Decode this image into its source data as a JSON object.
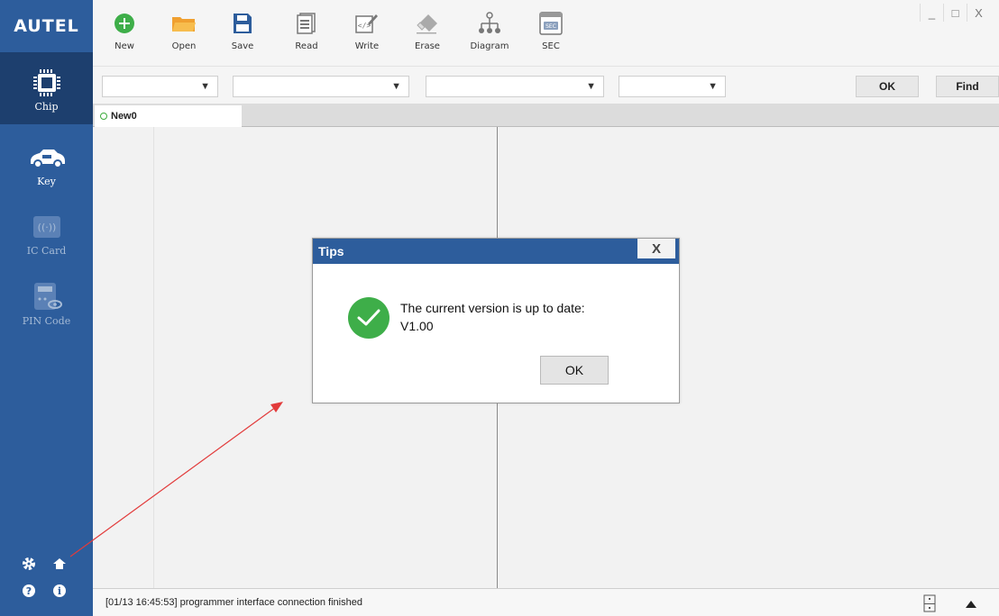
{
  "app": {
    "logo": "AUTEL"
  },
  "colors": {
    "sidebar": "#2d5d9c",
    "sidebar_active": "#1d3f6e",
    "success": "#3eae49",
    "annotation": "#e23b3b"
  },
  "sidebar": {
    "items": [
      {
        "label": "Chip",
        "icon": "chip-icon",
        "active": true
      },
      {
        "label": "Key",
        "icon": "car-key-icon"
      },
      {
        "label": "IC Card",
        "icon": "ic-card-icon",
        "disabled": true
      },
      {
        "label": "PIN Code",
        "icon": "pin-code-icon",
        "disabled": true
      }
    ],
    "bottom_icons": [
      "settings-icon",
      "home-icon",
      "help-icon",
      "info-icon"
    ]
  },
  "toolbar": {
    "items": [
      {
        "label": "New",
        "icon": "plus-circle-icon"
      },
      {
        "label": "Open",
        "icon": "folder-icon"
      },
      {
        "label": "Save",
        "icon": "floppy-icon"
      },
      {
        "label": "Read",
        "icon": "read-icon"
      },
      {
        "label": "Write",
        "icon": "write-icon"
      },
      {
        "label": "Erase",
        "icon": "eraser-icon"
      },
      {
        "label": "Diagram",
        "icon": "diagram-icon"
      },
      {
        "label": "SEC",
        "icon": "sec-icon"
      }
    ],
    "window_controls": {
      "minimize": "_",
      "maximize": "□",
      "close": "X"
    }
  },
  "selectors": {
    "selects": [
      "",
      "",
      "",
      ""
    ],
    "arrow": "▼",
    "ok_label": "OK",
    "find_label": "Find"
  },
  "tabs": [
    {
      "label": "New0"
    }
  ],
  "status": {
    "message": "[01/13 16:45:53] programmer interface connection finished",
    "right_icons": [
      "split-icon",
      "expand-up-icon"
    ]
  },
  "dialog": {
    "title": "Tips",
    "close": "X",
    "message_line1": "The current version is up to date:",
    "message_line2": "V1.00",
    "ok_label": "OK"
  }
}
